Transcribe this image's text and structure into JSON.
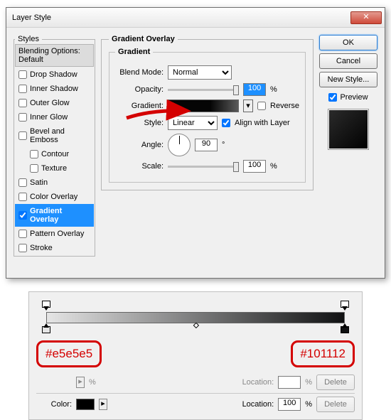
{
  "dialog": {
    "title": "Layer Style",
    "styles_legend": "Styles",
    "blend_header": "Blending Options: Default",
    "items": [
      {
        "label": "Drop Shadow",
        "checked": false,
        "selected": false,
        "sub": false
      },
      {
        "label": "Inner Shadow",
        "checked": false,
        "selected": false,
        "sub": false
      },
      {
        "label": "Outer Glow",
        "checked": false,
        "selected": false,
        "sub": false
      },
      {
        "label": "Inner Glow",
        "checked": false,
        "selected": false,
        "sub": false
      },
      {
        "label": "Bevel and Emboss",
        "checked": false,
        "selected": false,
        "sub": false
      },
      {
        "label": "Contour",
        "checked": false,
        "selected": false,
        "sub": true
      },
      {
        "label": "Texture",
        "checked": false,
        "selected": false,
        "sub": true
      },
      {
        "label": "Satin",
        "checked": false,
        "selected": false,
        "sub": false
      },
      {
        "label": "Color Overlay",
        "checked": false,
        "selected": false,
        "sub": false
      },
      {
        "label": "Gradient Overlay",
        "checked": true,
        "selected": true,
        "sub": false
      },
      {
        "label": "Pattern Overlay",
        "checked": false,
        "selected": false,
        "sub": false
      },
      {
        "label": "Stroke",
        "checked": false,
        "selected": false,
        "sub": false
      }
    ],
    "panel_title": "Gradient Overlay",
    "group_title": "Gradient",
    "labels": {
      "blend_mode": "Blend Mode:",
      "opacity": "Opacity:",
      "gradient": "Gradient:",
      "style": "Style:",
      "angle": "Angle:",
      "scale": "Scale:",
      "reverse": "Reverse",
      "align": "Align with Layer"
    },
    "values": {
      "blend_mode": "Normal",
      "opacity": "100",
      "style": "Linear",
      "angle": "90",
      "scale": "100",
      "reverse_checked": false,
      "align_checked": true,
      "pct": "%",
      "deg": "°"
    },
    "buttons": {
      "ok": "OK",
      "cancel": "Cancel",
      "new_style": "New Style...",
      "preview": "Preview",
      "preview_checked": true
    }
  },
  "grad_editor": {
    "left_color": "#e5e5e5",
    "right_color": "#101112",
    "location_label": "Location:",
    "color_label": "Color:",
    "delete": "Delete",
    "location_value": "100",
    "pct": "%"
  }
}
